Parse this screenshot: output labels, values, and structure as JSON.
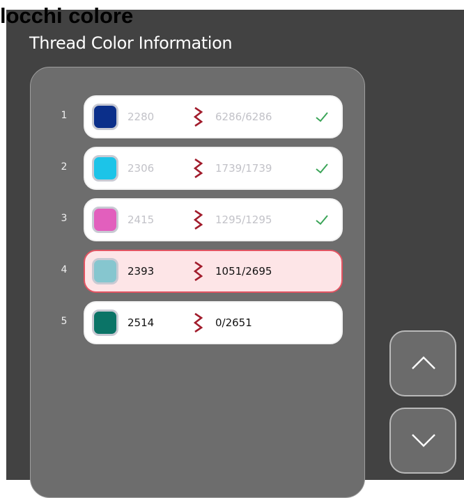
{
  "caption": "locchi colore",
  "screen": {
    "title": "Thread Color Information"
  },
  "threads": [
    {
      "index": "1",
      "code": "2280",
      "count": "6286/6286",
      "color": "#0b2f8a",
      "done": true,
      "active": false
    },
    {
      "index": "2",
      "code": "2306",
      "count": "1739/1739",
      "color": "#1cc4e8",
      "done": true,
      "active": false
    },
    {
      "index": "3",
      "code": "2415",
      "count": "1295/1295",
      "color": "#e25fbd",
      "done": true,
      "active": false
    },
    {
      "index": "4",
      "code": "2393",
      "count": "1051/2695",
      "color": "#86c6cf",
      "done": false,
      "active": true
    },
    {
      "index": "5",
      "code": "2514",
      "count": "0/2651",
      "color": "#0b7467",
      "done": false,
      "active": false
    }
  ],
  "icons": {
    "stitch": "zigzag-stitch-icon",
    "done": "checkmark-icon",
    "scroll_up": "chevron-up-icon",
    "scroll_down": "chevron-down-icon"
  },
  "colors": {
    "background": "#424242",
    "panel": "#6d6d6d",
    "active_fill": "#fde5e7",
    "active_border": "#e25462",
    "stitch_icon": "#a11c2c",
    "check": "#3aa457"
  }
}
